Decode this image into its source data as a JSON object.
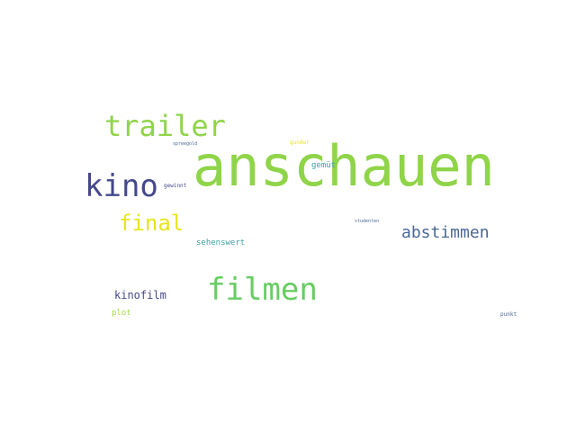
{
  "palette": {
    "lime": "#8fd449",
    "indigo": "#45488a",
    "yellow": "#e7e520",
    "slate_blue": "#4a6796",
    "teal": "#3e9fa2",
    "green": "#66cd60"
  },
  "words": [
    {
      "key": "anschauen",
      "text": "anschauen",
      "color": "#8fd449"
    },
    {
      "key": "trailer",
      "text": "trailer",
      "color": "#8fd449"
    },
    {
      "key": "kino",
      "text": "kino",
      "color": "#45488a"
    },
    {
      "key": "final",
      "text": "final",
      "color": "#e7e520"
    },
    {
      "key": "filmen",
      "text": "filmen",
      "color": "#66cd60"
    },
    {
      "key": "abstimmen",
      "text": "abstimmen",
      "color": "#4a6796"
    },
    {
      "key": "kinofilm",
      "text": "kinofilm",
      "color": "#45488a"
    },
    {
      "key": "sehenswert",
      "text": "sehenswert",
      "color": "#3e9fa2"
    },
    {
      "key": "plot",
      "text": "plot",
      "color": "#a8d84e"
    },
    {
      "key": "gemut",
      "text": "gemüt",
      "color": "#3e9fa2"
    },
    {
      "key": "gewinnt",
      "text": "gewinnt",
      "color": "#45488a"
    },
    {
      "key": "spreegold",
      "text": "spreegold",
      "color": "#4a6796"
    },
    {
      "key": "gunder",
      "text": "gunder",
      "color": "#e7e520"
    },
    {
      "key": "studenten",
      "text": "studenten",
      "color": "#4a6796"
    },
    {
      "key": "punkt",
      "text": "punkt",
      "color": "#4a6796"
    }
  ]
}
